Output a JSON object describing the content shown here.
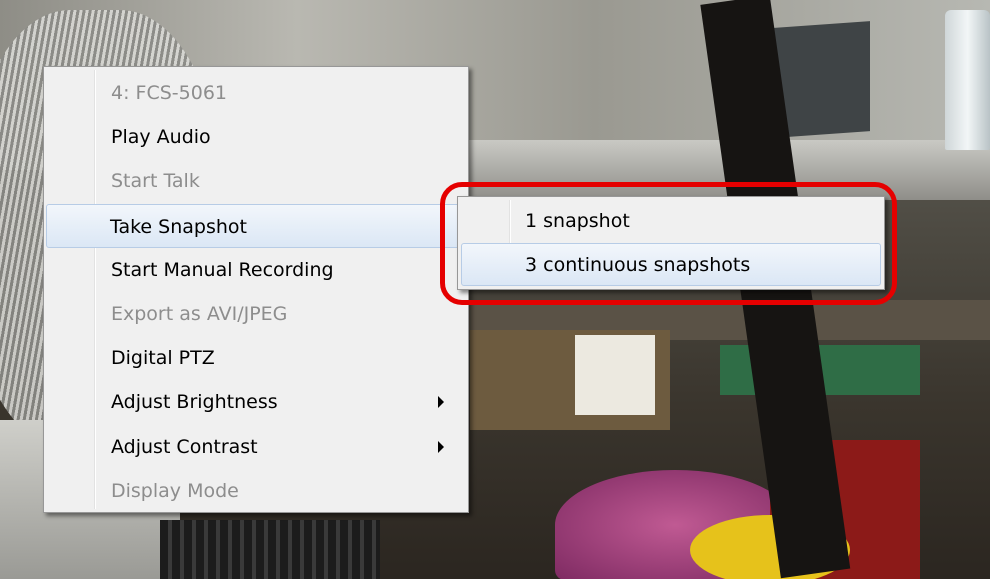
{
  "context_menu": {
    "items": [
      {
        "label": "4: FCS-5061",
        "enabled": false
      },
      {
        "label": "Play Audio",
        "enabled": true
      },
      {
        "label": "Start Talk",
        "enabled": false
      },
      {
        "label": "Take Snapshot",
        "enabled": true,
        "highlighted": true,
        "has_submenu": true
      },
      {
        "label": "Start Manual Recording",
        "enabled": true
      },
      {
        "label": "Export as AVI/JPEG",
        "enabled": false
      },
      {
        "label": "Digital PTZ",
        "enabled": true
      },
      {
        "label": "Adjust Brightness",
        "enabled": true,
        "has_submenu": true
      },
      {
        "label": "Adjust Contrast",
        "enabled": true,
        "has_submenu": true
      },
      {
        "label": "Display Mode",
        "enabled": false
      }
    ]
  },
  "snapshot_submenu": {
    "items": [
      {
        "label": "1 snapshot"
      },
      {
        "label": "3 continuous snapshots",
        "highlighted": true
      }
    ]
  },
  "icons": {
    "submenu_arrow": "chevron-right-icon"
  },
  "colors": {
    "menu_bg": "#f0f0f0",
    "highlight": "#dbe7f5",
    "disabled_text": "#8d8d8d",
    "callout": "#e50000"
  }
}
